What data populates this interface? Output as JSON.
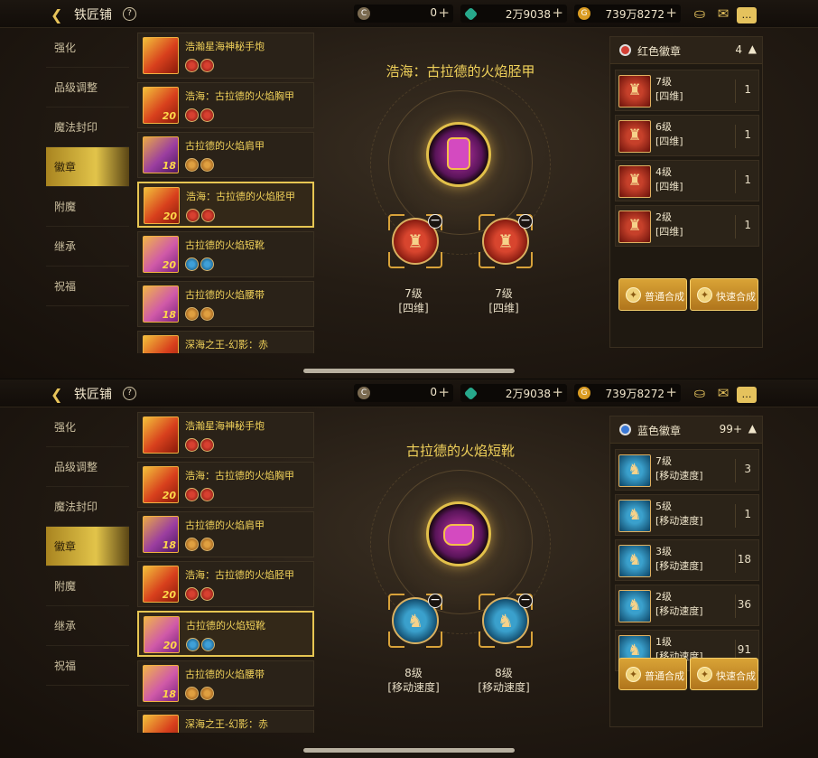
{
  "screens": [
    {
      "topbar": {
        "title": "铁匠铺",
        "help": "?",
        "currency1": "0",
        "currency2": "2万9038",
        "currency3": "739万8272"
      },
      "nav": [
        "强化",
        "品级调整",
        "魔法封印",
        "徽章",
        "附魔",
        "继承",
        "祝福"
      ],
      "nav_active": 3,
      "list": [
        {
          "name": "浩瀚星海神秘手炮",
          "level": "",
          "slots": "red"
        },
        {
          "name": "浩海：古拉德的火焰胸甲",
          "level": "20",
          "slots": "red"
        },
        {
          "name": "古拉德的火焰肩甲",
          "level": "18",
          "slots": "orange"
        },
        {
          "name": "浩海：古拉德的火焰胫甲",
          "level": "20",
          "slots": "red"
        },
        {
          "name": "古拉德的火焰短靴",
          "level": "20",
          "slots": "blue"
        },
        {
          "name": "古拉德的火焰腰带",
          "level": "18",
          "slots": "orange"
        },
        {
          "name": "深海之王-幻影：赤",
          "level": "",
          "slots": ""
        }
      ],
      "selected": 3,
      "center": {
        "title": "浩海：古拉德的火焰胫甲",
        "emblem1_level": "7级",
        "emblem1_stat": "[四维]",
        "emblem2_level": "7级",
        "emblem2_stat": "[四维]"
      },
      "panel": {
        "title": "红色徽章",
        "count": "4",
        "rows": [
          {
            "level": "7级",
            "stat": "[四维]",
            "count": "1"
          },
          {
            "level": "6级",
            "stat": "[四维]",
            "count": "1"
          },
          {
            "level": "4级",
            "stat": "[四维]",
            "count": "1"
          },
          {
            "level": "2级",
            "stat": "[四维]",
            "count": "1"
          }
        ],
        "btn1": "普通合成",
        "btn2": "快速合成"
      }
    },
    {
      "topbar": {
        "title": "铁匠铺",
        "help": "?",
        "currency1": "0",
        "currency2": "2万9038",
        "currency3": "739万8272"
      },
      "nav": [
        "强化",
        "品级调整",
        "魔法封印",
        "徽章",
        "附魔",
        "继承",
        "祝福"
      ],
      "nav_active": 3,
      "list": [
        {
          "name": "浩瀚星海神秘手炮",
          "level": "",
          "slots": "red"
        },
        {
          "name": "浩海：古拉德的火焰胸甲",
          "level": "20",
          "slots": "red"
        },
        {
          "name": "古拉德的火焰肩甲",
          "level": "18",
          "slots": "orange"
        },
        {
          "name": "浩海：古拉德的火焰胫甲",
          "level": "20",
          "slots": "red"
        },
        {
          "name": "古拉德的火焰短靴",
          "level": "20",
          "slots": "blue"
        },
        {
          "name": "古拉德的火焰腰带",
          "level": "18",
          "slots": "orange"
        },
        {
          "name": "深海之王-幻影：赤",
          "level": "",
          "slots": ""
        }
      ],
      "selected": 4,
      "center": {
        "title": "古拉德的火焰短靴",
        "emblem1_level": "8级",
        "emblem1_stat": "[移动速度]",
        "emblem2_level": "8级",
        "emblem2_stat": "[移动速度]"
      },
      "panel": {
        "title": "蓝色徽章",
        "count": "99+",
        "rows": [
          {
            "level": "7级",
            "stat": "[移动速度]",
            "count": "3"
          },
          {
            "level": "5级",
            "stat": "[移动速度]",
            "count": "1"
          },
          {
            "level": "3级",
            "stat": "[移动速度]",
            "count": "18"
          },
          {
            "level": "2级",
            "stat": "[移动速度]",
            "count": "36"
          },
          {
            "level": "1级",
            "stat": "[移动速度]",
            "count": "91"
          }
        ],
        "btn1": "普通合成",
        "btn2": "快速合成"
      }
    }
  ]
}
